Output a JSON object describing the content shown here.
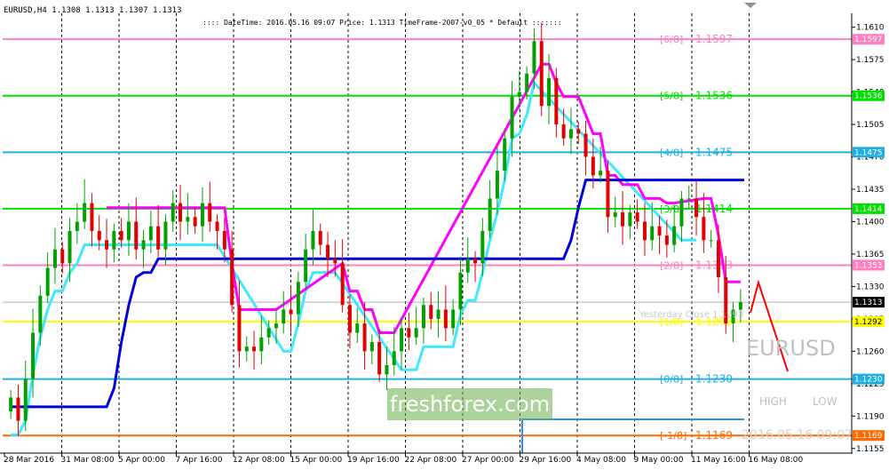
{
  "header": {
    "title": "EURUSD,H4  1.1308 1.1313 1.1307 1.1313",
    "info": ":::: DateTime: 2016.05.16 09:07   Price: 1.1313   TimeFrame-2007-v0_05   *  Default :::::::"
  },
  "watermark": {
    "brand": "freshforex.com",
    "symbol": "EURUSD",
    "high_label": "HIGH",
    "low_label": "LOW",
    "timestamp": "2016.05.16 09:07"
  },
  "colors": {
    "background": "#ffffff",
    "bull": "#00a000",
    "bear": "#e00000",
    "up_arrow": "#ff0000"
  },
  "chart_data": {
    "type": "candlestick",
    "ylim": [
      1.115,
      1.1625
    ],
    "x_tick_labels": [
      "28 Mar 2016",
      "31 Mar 08:00",
      "5 Apr 00:00",
      "7 Apr 16:00",
      "12 Apr 08:00",
      "15 Apr 00:00",
      "19 Apr 16:00",
      "22 Apr 08:00",
      "27 Apr 00:00",
      "29 Apr 16:00",
      "4 May 08:00",
      "9 May 00:00",
      "11 May 16:00",
      "16 May 08:00"
    ],
    "y_tick_labels": [
      "1.1610",
      "1.1575",
      "1.1540",
      "1.1505",
      "1.1470",
      "1.1435",
      "1.1400",
      "1.1365",
      "1.1330",
      "1.1295",
      "1.1260",
      "1.1225",
      "1.1190",
      "1.1155"
    ],
    "murrey_levels": [
      {
        "label": "[6/8]",
        "value": "1.1597",
        "price": 1.1597,
        "color": "#ff80c0"
      },
      {
        "label": "[5/8]",
        "value": "1.1536",
        "price": 1.1536,
        "color": "#00e000"
      },
      {
        "label": "[4/8]",
        "value": "1.1475",
        "price": 1.1475,
        "color": "#20b0e0"
      },
      {
        "label": "[3/8]",
        "value": "1.1414",
        "price": 1.1414,
        "color": "#00e000"
      },
      {
        "label": "[2/8]",
        "value": "1.1353",
        "price": 1.1353,
        "color": "#ff80c0"
      },
      {
        "label": "[1/8]",
        "value": "1.1292",
        "price": 1.1292,
        "color": "#ffff00"
      },
      {
        "label": "[0/8]",
        "value": "1.1230",
        "price": 1.123,
        "color": "#20b0e0"
      },
      {
        "label": "[-1/8]",
        "value": "1.1169",
        "price": 1.1169,
        "color": "#ff6a00"
      }
    ],
    "price_labels": [
      "1.1597",
      "1.1536",
      "1.1475",
      "1.1414",
      "1.1353",
      "1.1313",
      "1.1292",
      "1.1230",
      "1.1169"
    ],
    "yesterday_close": "Yesterday Close 1.1293",
    "current_price": 1.1313,
    "closes": [
      1.121,
      1.1185,
      1.123,
      1.128,
      1.132,
      1.135,
      1.137,
      1.1355,
      1.139,
      1.14,
      1.142,
      1.139,
      1.138,
      1.137,
      1.139,
      1.138,
      1.14,
      1.137,
      1.138,
      1.1395,
      1.137,
      1.14,
      1.142,
      1.14,
      1.1405,
      1.1395,
      1.142,
      1.14,
      1.139,
      1.137,
      1.131,
      1.126,
      1.1265,
      1.126,
      1.1275,
      1.1285,
      1.129,
      1.1305,
      1.13,
      1.1335,
      1.137,
      1.139,
      1.1375,
      1.136,
      1.1355,
      1.131,
      1.128,
      1.129,
      1.126,
      1.127,
      1.1235,
      1.1245,
      1.126,
      1.1285,
      1.1275,
      1.1285,
      1.131,
      1.1295,
      1.1305,
      1.1285,
      1.1305,
      1.1345,
      1.136,
      1.1355,
      1.139,
      1.1425,
      1.1455,
      1.149,
      1.1535,
      1.154,
      1.156,
      1.1595,
      1.1525,
      1.1555,
      1.1505,
      1.149,
      1.15,
      1.1495,
      1.147,
      1.145,
      1.1455,
      1.1405,
      1.141,
      1.1395,
      1.141,
      1.14,
      1.138,
      1.1395,
      1.1385,
      1.1375,
      1.1395,
      1.1425,
      1.1425,
      1.1405,
      1.138,
      1.138,
      1.134,
      1.129,
      1.1305,
      1.1313
    ],
    "series": [
      {
        "name": "cyan trend line",
        "color": "#40e8ff"
      },
      {
        "name": "magenta trend line",
        "color": "#ff00ff"
      },
      {
        "name": "blue step line",
        "color": "#0000dd"
      }
    ]
  }
}
